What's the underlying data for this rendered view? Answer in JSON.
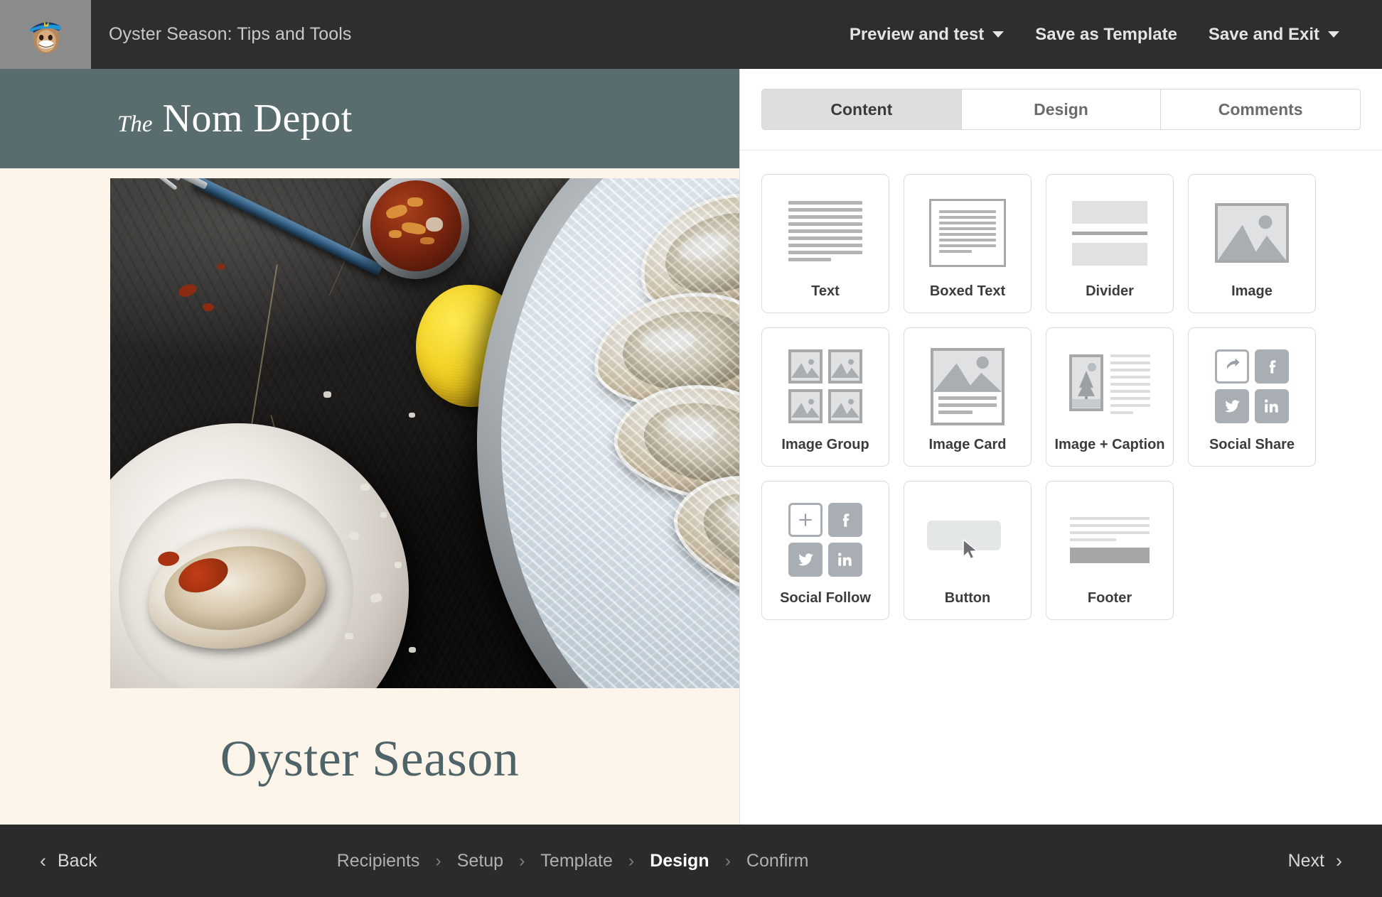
{
  "topbar": {
    "logo_icon": "mailchimp-monkey-icon",
    "campaign_title": "Oyster Season: Tips and Tools",
    "actions": [
      {
        "label": "Preview and test",
        "has_caret": true
      },
      {
        "label": "Save as Template",
        "has_caret": false
      },
      {
        "label": "Save and Exit",
        "has_caret": true
      }
    ]
  },
  "email": {
    "brand_prefix": "The",
    "brand_name": "Nom Depot",
    "hero_image_alt": "Oysters on ice with lemon, cocktail sauce and a plate",
    "headline": "Oyster Season",
    "header_bg": "#5a6d6e",
    "body_bg": "#fdf5e9",
    "headline_color": "#4e6468"
  },
  "panel": {
    "tabs": [
      {
        "label": "Content",
        "active": true
      },
      {
        "label": "Design",
        "active": false
      },
      {
        "label": "Comments",
        "active": false
      }
    ],
    "blocks": [
      {
        "label": "Text",
        "icon": "text-lines-icon"
      },
      {
        "label": "Boxed Text",
        "icon": "boxed-text-icon"
      },
      {
        "label": "Divider",
        "icon": "divider-icon"
      },
      {
        "label": "Image",
        "icon": "image-placeholder-icon"
      },
      {
        "label": "Image Group",
        "icon": "image-group-icon"
      },
      {
        "label": "Image Card",
        "icon": "image-card-icon"
      },
      {
        "label": "Image + Caption",
        "icon": "image-caption-icon"
      },
      {
        "label": "Social Share",
        "icon": "social-share-icon"
      },
      {
        "label": "Social Follow",
        "icon": "social-follow-icon"
      },
      {
        "label": "Button",
        "icon": "button-cursor-icon"
      },
      {
        "label": "Footer",
        "icon": "footer-icon"
      }
    ]
  },
  "bottombar": {
    "back_label": "Back",
    "next_label": "Next",
    "steps": [
      {
        "label": "Recipients",
        "active": false
      },
      {
        "label": "Setup",
        "active": false
      },
      {
        "label": "Template",
        "active": false
      },
      {
        "label": "Design",
        "active": true
      },
      {
        "label": "Confirm",
        "active": false
      }
    ],
    "separator": "›"
  }
}
